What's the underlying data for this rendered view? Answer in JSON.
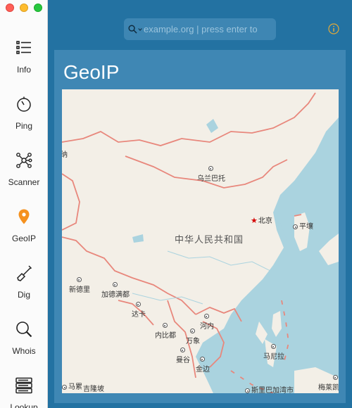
{
  "sidebar": {
    "items": [
      {
        "id": "info",
        "label": "Info",
        "icon": "list-icon"
      },
      {
        "id": "ping",
        "label": "Ping",
        "icon": "stopwatch-icon"
      },
      {
        "id": "scanner",
        "label": "Scanner",
        "icon": "network-nodes-icon"
      },
      {
        "id": "geoip",
        "label": "GeoIP",
        "icon": "location-pin-icon",
        "active": true
      },
      {
        "id": "dig",
        "label": "Dig",
        "icon": "shovel-icon"
      },
      {
        "id": "whois",
        "label": "Whois",
        "icon": "magnifier-icon"
      },
      {
        "id": "lookup",
        "label": "Lookup",
        "icon": "server-stack-icon"
      }
    ]
  },
  "toolbar": {
    "search_value": "example.org | press enter to",
    "search_placeholder": "example.org | press enter to",
    "info_icon": "info-circle-icon"
  },
  "panel": {
    "title": "GeoIP"
  },
  "map": {
    "labels": {
      "country": "中华人民共和国",
      "ulaanbaatar": "乌兰巴托",
      "beijing": "北京",
      "pyongyang": "平壤",
      "new_delhi": "新德里",
      "kathmandu": "加德满都",
      "dhaka": "达卡",
      "naypyidaw": "内比都",
      "hanoi": "河内",
      "vientiane": "万象",
      "bangkok": "曼谷",
      "phnom_penh": "金边",
      "manila": "马尼拉",
      "colombo": "斯里巴加湾市",
      "partial_west": "纳",
      "partial_bottom_left": "马累",
      "kuala": "吉隆坡",
      "melek": "梅莱凯奥克"
    }
  },
  "colors": {
    "accent": "#1f6f9c",
    "active_icon": "#f5911e",
    "border_red": "#e8877c"
  }
}
